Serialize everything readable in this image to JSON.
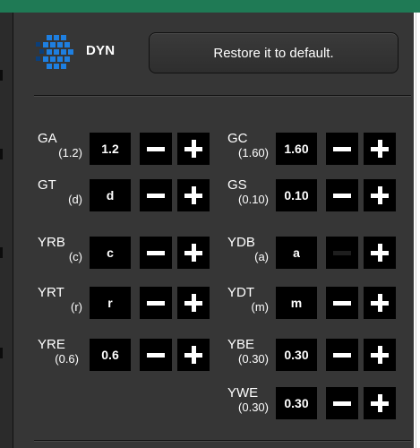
{
  "header": {
    "logo_text": "DYN",
    "restore_label": "Restore it to default."
  },
  "params": {
    "ga": {
      "name": "GA",
      "default": "(1.2)",
      "value": "1.2"
    },
    "gc": {
      "name": "GC",
      "default": "(1.60)",
      "value": "1.60"
    },
    "gt": {
      "name": "GT",
      "default": "(d)",
      "value": "d"
    },
    "gs": {
      "name": "GS",
      "default": "(0.10)",
      "value": "0.10"
    },
    "yrb": {
      "name": "YRB",
      "default": "(c)",
      "value": "c"
    },
    "ydb": {
      "name": "YDB",
      "default": "(a)",
      "value": "a",
      "minus_enabled": false
    },
    "yrt": {
      "name": "YRT",
      "default": "(r)",
      "value": "r"
    },
    "ydt": {
      "name": "YDT",
      "default": "(m)",
      "value": "m"
    },
    "yre": {
      "name": "YRE",
      "default": "(0.6)",
      "value": "0.6"
    },
    "ybe": {
      "name": "YBE",
      "default": "(0.30)",
      "value": "0.30"
    },
    "ywe": {
      "name": "YWE",
      "default": "(0.30)",
      "value": "0.30"
    }
  },
  "icons": {
    "logo": "dyn-logo-icon",
    "minus": "minus-icon",
    "plus": "plus-icon"
  },
  "colors": {
    "panel": "#363636",
    "accent": "#1f7a55",
    "value_box": "#000000",
    "logo_blue": "#1e7fe0"
  }
}
